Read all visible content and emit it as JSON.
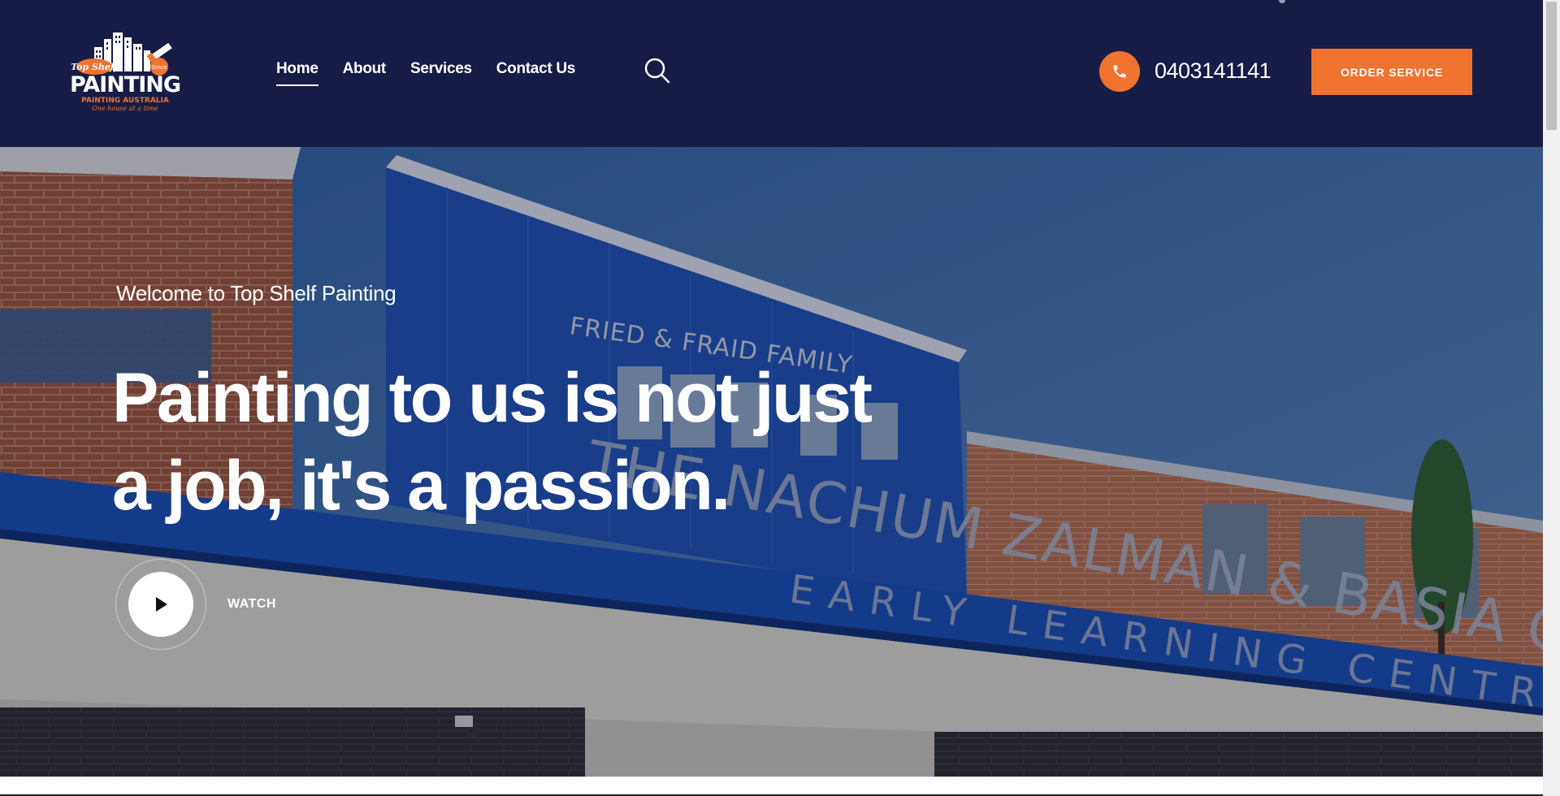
{
  "brand": {
    "logo_alt": "Top Shelf Painting Australia",
    "logo_lines": [
      "Top Shelf",
      "PAINTING",
      "PAINTING AUSTRALIA",
      "One house at a time",
      "Since"
    ]
  },
  "nav": {
    "items": [
      {
        "label": "Home",
        "active": true
      },
      {
        "label": "About",
        "active": false
      },
      {
        "label": "Services",
        "active": false
      },
      {
        "label": "Contact Us",
        "active": false
      }
    ]
  },
  "header": {
    "phone": "0403141141",
    "order_button": "ORDER SERVICE"
  },
  "hero": {
    "eyebrow": "Welcome to Top Shelf Painting",
    "headline": "Painting to us is not just a job, it's a passion.",
    "watch_label": "WATCH",
    "signage": {
      "upper": "FRIED & FRAID FAMILY",
      "main": "THE NACHUM ZALMAN & BASIA GUREWICZ",
      "lower": "EARLY LEARNING CENTRE"
    }
  },
  "colors": {
    "header_bg": "#161c45",
    "accent": "#f0732f",
    "text_on_dark": "#ffffff"
  }
}
